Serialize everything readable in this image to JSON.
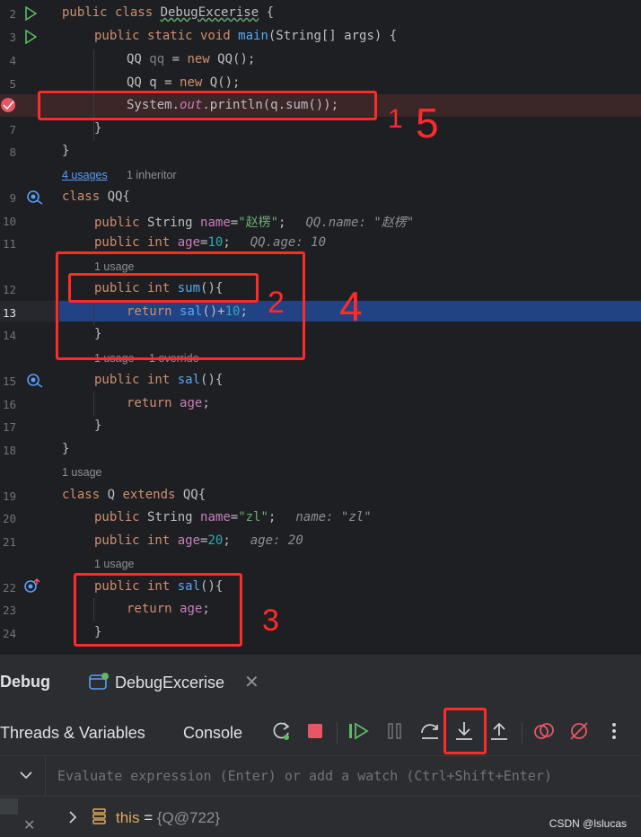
{
  "editor": {
    "lines": {
      "l2": {
        "num": "2"
      },
      "l3": {
        "num": "3"
      },
      "l4": {
        "num": "4"
      },
      "l5": {
        "num": "5"
      },
      "l6": {
        "num": ""
      },
      "l7": {
        "num": "7"
      },
      "l8": {
        "num": "8"
      },
      "l9": {
        "num": "9"
      },
      "l10": {
        "num": "10"
      },
      "l11": {
        "num": "11"
      },
      "l12": {
        "num": "12"
      },
      "l13": {
        "num": "13"
      },
      "l14": {
        "num": "14"
      },
      "l15": {
        "num": "15"
      },
      "l16": {
        "num": "16"
      },
      "l17": {
        "num": "17"
      },
      "l18": {
        "num": "18"
      },
      "l19": {
        "num": "19"
      },
      "l20": {
        "num": "20"
      },
      "l21": {
        "num": "21"
      },
      "l22": {
        "num": "22"
      },
      "l23": {
        "num": "23"
      },
      "l24": {
        "num": "24"
      }
    },
    "code": {
      "l2": {
        "a": "public class ",
        "b": "DebugExcerise",
        " c": " {"
      },
      "l3": {
        "a": "public static void ",
        "b": "main",
        "c": "(String[] args) {"
      },
      "l4": {
        "a": "QQ ",
        "b": "qq",
        "c": " = ",
        "d": "new ",
        "e": "QQ();"
      },
      "l5": {
        "a": "QQ q = ",
        "b": "new ",
        "c": "Q();"
      },
      "l6": {
        "a": "System.",
        "b": "out",
        "c": ".println(q.sum());"
      },
      "l7": "}",
      "l8": "}",
      "l9": {
        "a": "class ",
        "b": "QQ{"
      },
      "l10": {
        "a": "public ",
        "b": "String ",
        "c": "name",
        "d": "=",
        "e": "\"赵楞\"",
        "f": ";",
        "hint": "QQ.name: \"赵楞\""
      },
      "l11": {
        "a": "public int ",
        "b": "age",
        "c": "=",
        "d": "10",
        "e": ";",
        "hint": "QQ.age: 10"
      },
      "l12": {
        "a": "public int ",
        "b": "sum",
        "c": "(){"
      },
      "l13": {
        "a": "return ",
        "b": "sal",
        "c": "()+",
        "d": "10",
        "e": ";"
      },
      "l14": "}",
      "l15": {
        "a": "public int ",
        "b": "sal",
        "c": "(){"
      },
      "l16": {
        "a": "return ",
        "b": "age",
        "c": ";"
      },
      "l17": "}",
      "l18": "}",
      "l19": {
        "a": "class ",
        "b": "Q ",
        "c": "extends ",
        "d": "QQ{"
      },
      "l20": {
        "a": "public ",
        "b": "String ",
        "c": "name",
        "d": "=",
        "e": "\"zl\"",
        "f": ";",
        "hint": "name: \"zl\""
      },
      "l21": {
        "a": "public int ",
        "b": "age",
        "c": "=",
        "d": "20",
        "e": ";",
        "hint": "age: 20"
      },
      "l22": {
        "a": "public int ",
        "b": "sal",
        "c": "(){"
      },
      "l23": {
        "a": "return ",
        "b": "age",
        "c": ";"
      },
      "l24": "}"
    },
    "hints": {
      "usages_qq": "4 usages",
      "inheritor": "1 inheritor",
      "sum_usage": "1 usage",
      "sal_usage": "1 usage",
      "sal_override": "1 override",
      "q_usage": "1 usage",
      "q_sal_usage": "1 usage"
    },
    "annotations": {
      "a1": "1",
      "a5": "5",
      "a2": "2",
      "a4": "4",
      "a3": "3"
    }
  },
  "debug": {
    "title": "Debug",
    "session_tab": "DebugExcerise",
    "tabs": {
      "threads": "Threads & Variables",
      "console": "Console"
    },
    "evaluate_placeholder": "Evaluate expression (Enter) or add a watch (Ctrl+Shift+Enter)",
    "variable": {
      "name": "this",
      "eq": " = ",
      "value": "{Q@722}"
    }
  },
  "watermark": "CSDN @lslucas",
  "colors": {
    "accent": "#3574f0",
    "breakpoint": "#db5c5c",
    "annotation": "#ff2a2a"
  }
}
